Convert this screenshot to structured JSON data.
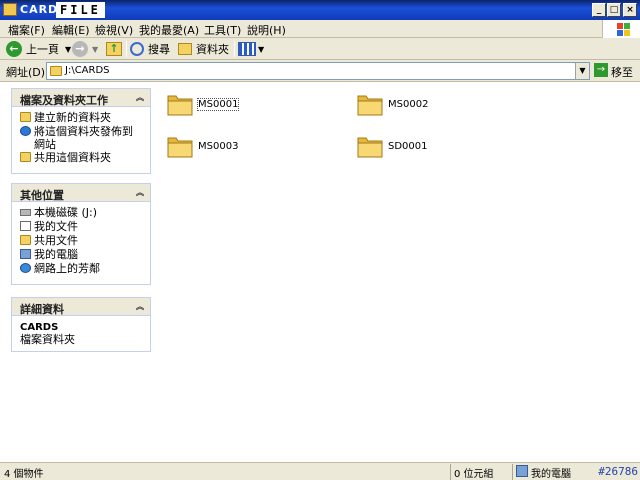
{
  "window": {
    "title": "CARDS",
    "logo": "FILE"
  },
  "menu": {
    "items": [
      "檔案(F)",
      "編輯(E)",
      "檢視(V)",
      "我的最愛(A)",
      "工具(T)",
      "說明(H)"
    ]
  },
  "toolbar": {
    "back_label": "上一頁",
    "search_label": "搜尋",
    "folders_label": "資料夾"
  },
  "address": {
    "label": "網址(D)",
    "value": "J:\\CARDS",
    "go_label": "移至"
  },
  "panels": {
    "file_tasks": {
      "title": "檔案及資料夾工作",
      "items": [
        "建立新的資料夾",
        "將這個資料夾發佈到網站",
        "共用這個資料夾"
      ]
    },
    "other_places": {
      "title": "其他位置",
      "items": [
        "本機磁碟 (J:)",
        "我的文件",
        "共用文件",
        "我的電腦",
        "網路上的芳鄰"
      ]
    },
    "details": {
      "title": "詳細資料",
      "name": "CARDS",
      "type": "檔案資料夾"
    }
  },
  "folders": [
    {
      "name": "MS0001"
    },
    {
      "name": "MS0002"
    },
    {
      "name": "MS0003"
    },
    {
      "name": "SD0001"
    }
  ],
  "status": {
    "count": "4 個物件",
    "size": "0 位元組",
    "location": "我的電腦",
    "id": "#26786"
  }
}
